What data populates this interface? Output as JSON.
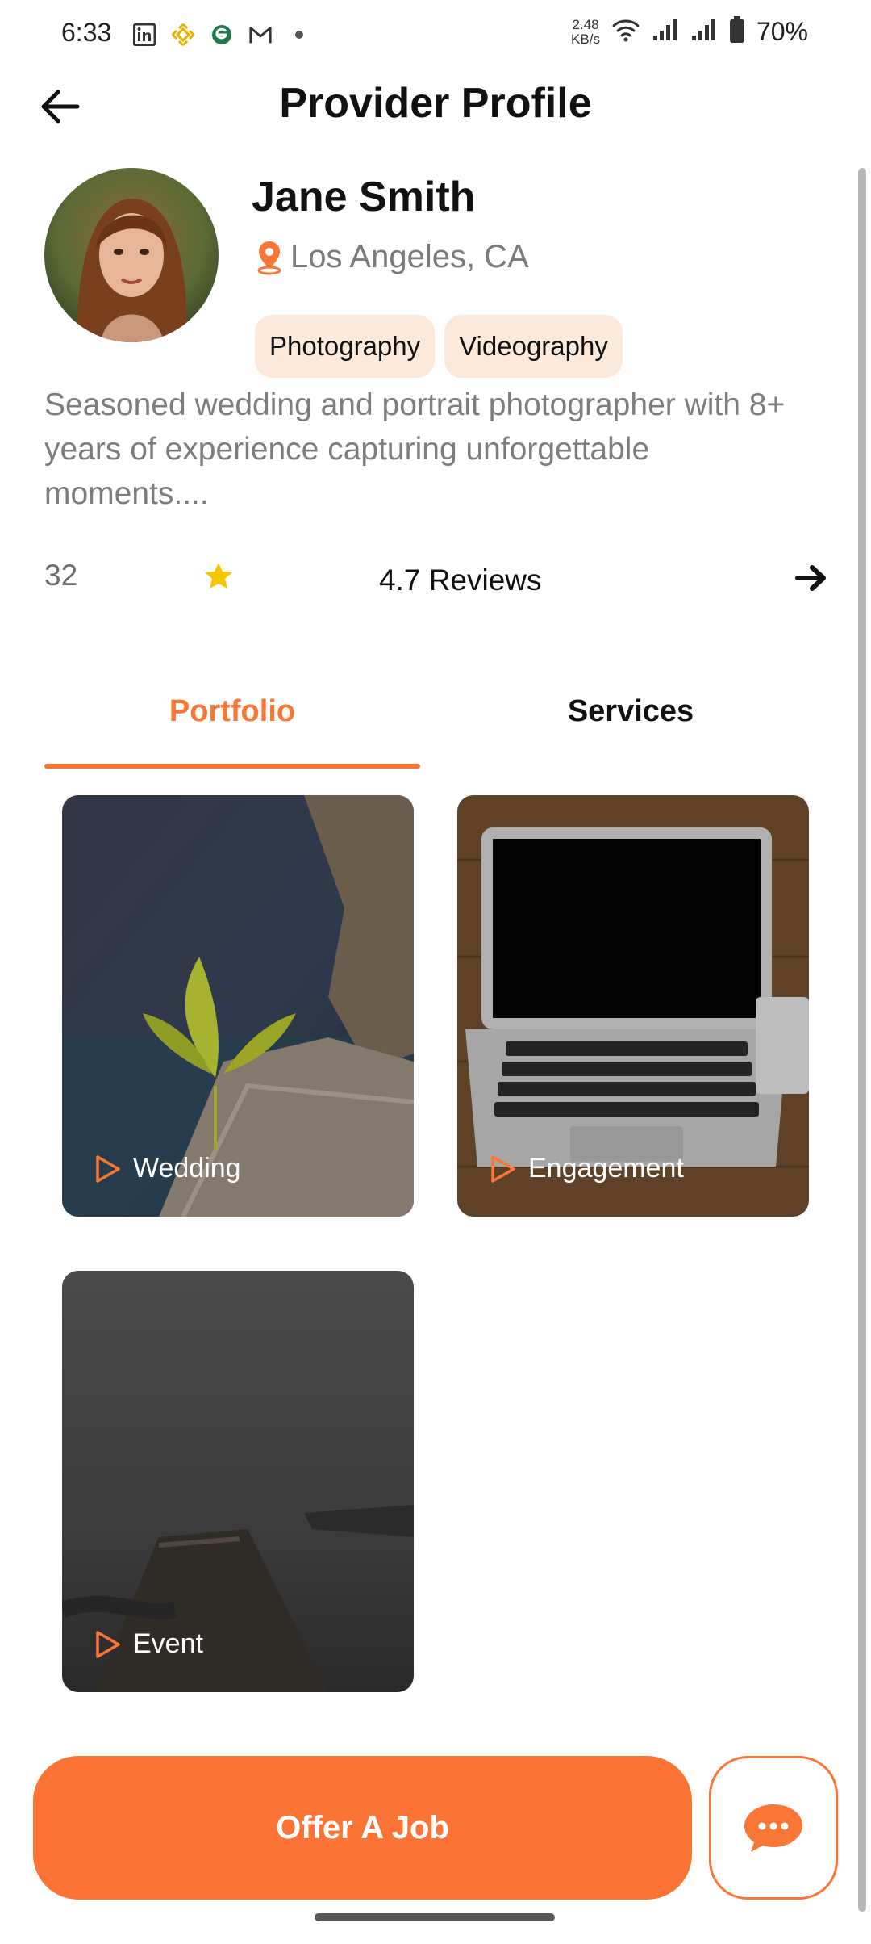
{
  "status_bar": {
    "time": "6:33",
    "app_icons": [
      "linkedin-icon",
      "binance-icon",
      "e-app-icon",
      "gmail-icon",
      "dot-icon"
    ],
    "net_speed_value": "2.48",
    "net_speed_unit": "KB/s",
    "battery": "70%"
  },
  "header": {
    "title": "Provider Profile"
  },
  "profile": {
    "name": "Jane Smith",
    "location": "Los Angeles, CA",
    "tags": [
      "Photography",
      "Videography"
    ],
    "bio": "Seasoned wedding and portrait photographer with 8+ years of experience capturing unforgettable moments....",
    "review_count": "32",
    "rating_text": "4.7 Reviews"
  },
  "tabs": {
    "portfolio": "Portfolio",
    "services": "Services",
    "active": "portfolio"
  },
  "portfolio": {
    "items": [
      {
        "label": "Wedding"
      },
      {
        "label": "Engagement"
      },
      {
        "label": "Event"
      }
    ]
  },
  "actions": {
    "offer_job": "Offer A Job"
  },
  "colors": {
    "accent": "#f97636",
    "chip_bg": "#fde9da",
    "star": "#f7c600",
    "muted_text": "#7d7d7d"
  }
}
